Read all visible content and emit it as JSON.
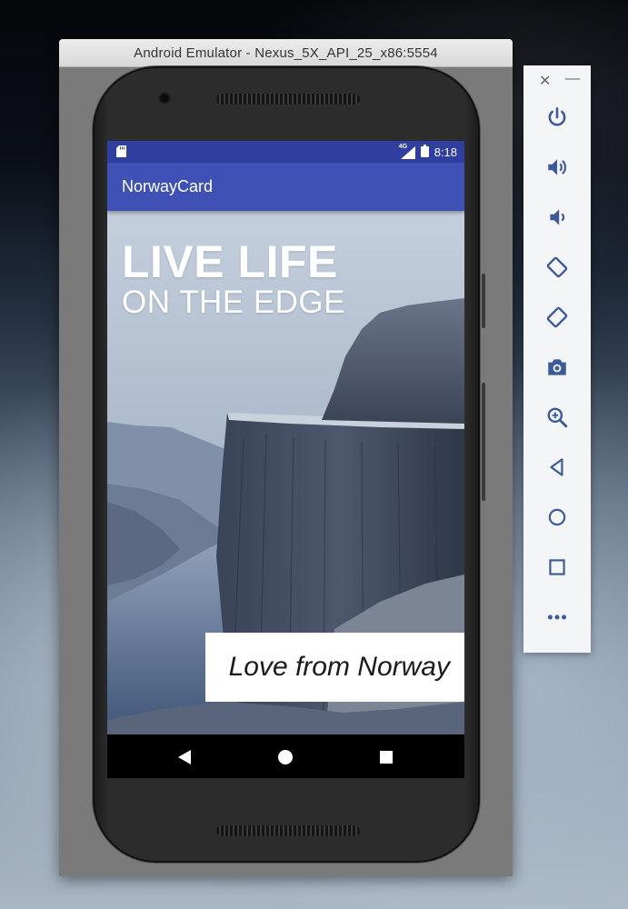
{
  "emulator": {
    "window_title": "Android Emulator - Nexus_5X_API_25_x86:5554"
  },
  "status_bar": {
    "network": "4G",
    "time": "8:18"
  },
  "app": {
    "title": "NorwayCard",
    "headline_line1": "LIVE LIFE",
    "headline_line2": "ON THE EDGE",
    "tagline": "Love from Norway"
  },
  "toolbar": {
    "close_glyph": "✕",
    "minimize_glyph": "—",
    "buttons": [
      "power-icon",
      "volume-up-icon",
      "volume-down-icon",
      "rotate-left-icon",
      "rotate-right-icon",
      "camera-icon",
      "zoom-icon",
      "back-icon",
      "home-icon",
      "overview-icon",
      "more-icon"
    ]
  },
  "colors": {
    "status_bar": "#303F9F",
    "app_bar": "#3F51B5",
    "toolbar_icon": "#3c5a99"
  }
}
